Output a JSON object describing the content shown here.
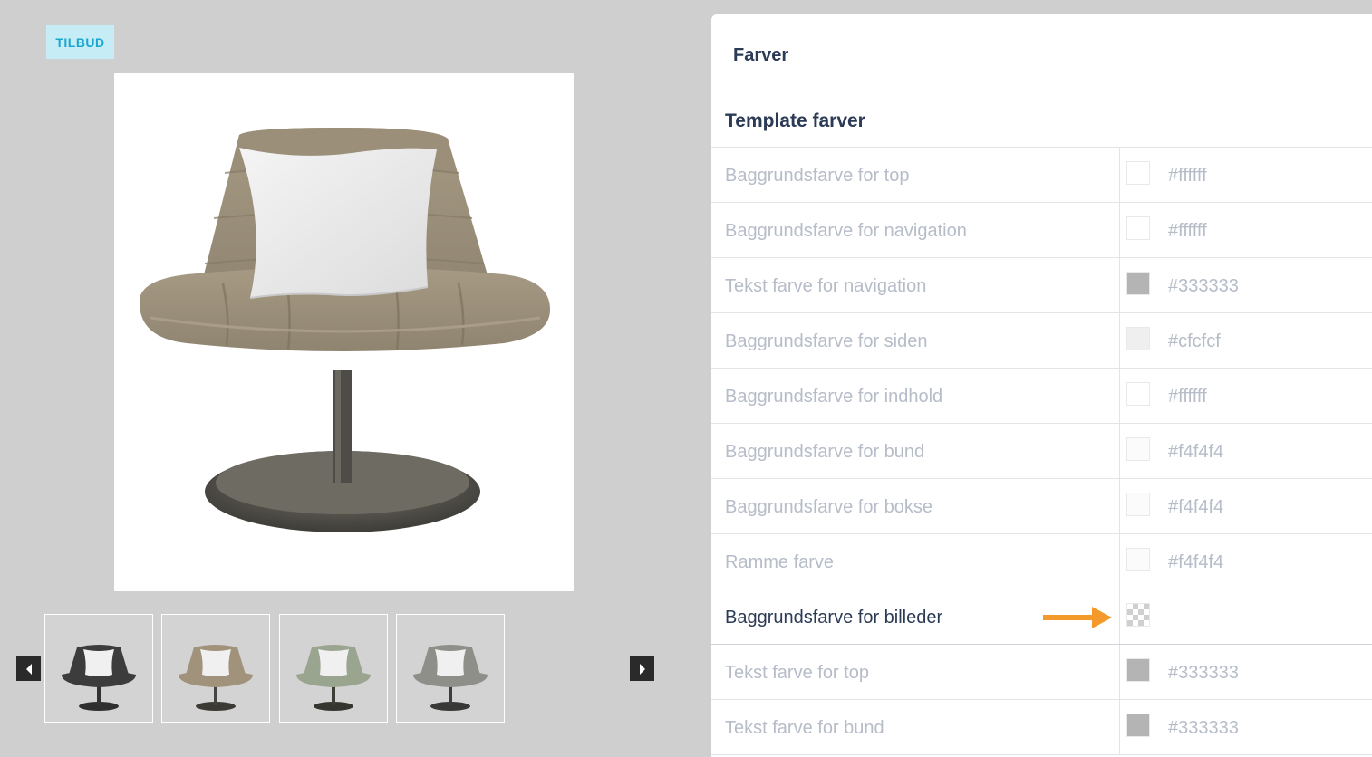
{
  "preview": {
    "badge": "TILBUD",
    "thumbnails": [
      {
        "name": "thumb-black",
        "fabric": "#3c3c3c"
      },
      {
        "name": "thumb-beige",
        "fabric": "#a0927b"
      },
      {
        "name": "thumb-green",
        "fabric": "#9aa590"
      },
      {
        "name": "thumb-grey",
        "fabric": "#8e8f88"
      }
    ]
  },
  "panel": {
    "title": "Farver",
    "section_title": "Template farver",
    "rows": [
      {
        "label": "Baggrundsfarve for top",
        "hex": "#ffffff",
        "color": "#ffffff"
      },
      {
        "label": "Baggrundsfarve for navigation",
        "hex": "#ffffff",
        "color": "#ffffff"
      },
      {
        "label": "Tekst farve for navigation",
        "hex": "#333333",
        "color": "#b4b4b4"
      },
      {
        "label": "Baggrundsfarve for siden",
        "hex": "#cfcfcf",
        "color": "#efefef"
      },
      {
        "label": "Baggrundsfarve for indhold",
        "hex": "#ffffff",
        "color": "#ffffff"
      },
      {
        "label": "Baggrundsfarve for bund",
        "hex": "#f4f4f4",
        "color": "#fbfbfb"
      },
      {
        "label": "Baggrundsfarve for bokse",
        "hex": "#f4f4f4",
        "color": "#fbfbfb"
      },
      {
        "label": "Ramme farve",
        "hex": "#f4f4f4",
        "color": "#fbfbfb"
      },
      {
        "label": "Baggrundsfarve for billeder",
        "hex": "",
        "color": "transparent",
        "active": true
      },
      {
        "label": "Tekst farve for top",
        "hex": "#333333",
        "color": "#b4b4b4"
      },
      {
        "label": "Tekst farve for bund",
        "hex": "#333333",
        "color": "#b4b4b4"
      }
    ]
  },
  "colors": {
    "accent_arrow": "#f39a2b",
    "heading": "#2b3a55",
    "muted_text": "#b6bcc8",
    "badge_bg": "#c6ecf6",
    "badge_text": "#1aa7cf"
  }
}
